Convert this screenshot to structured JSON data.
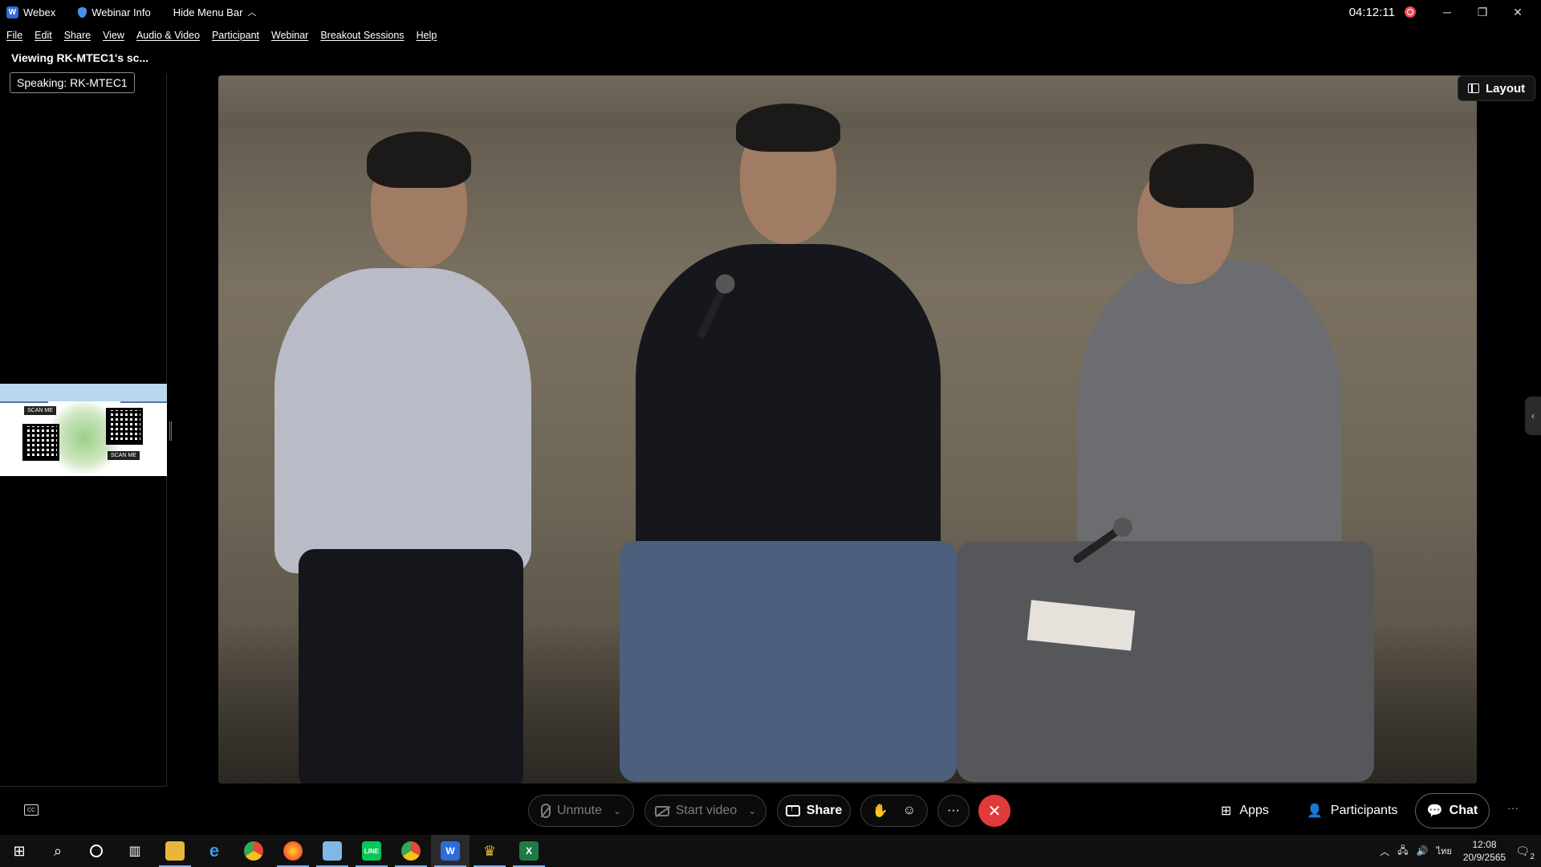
{
  "titlebar": {
    "app_name": "Webex",
    "webinar_info": "Webinar Info",
    "hide_menu": "Hide Menu Bar",
    "clock": "04:12:11"
  },
  "menu": [
    "File",
    "Edit",
    "Share",
    "View",
    "Audio & Video",
    "Participant",
    "Webinar",
    "Breakout Sessions",
    "Help"
  ],
  "left_panel": {
    "viewing": "Viewing RK-MTEC1's sc...",
    "speaking": "Speaking: RK-MTEC1",
    "thumb_tags": [
      "SCAN ME",
      "SCAN ME"
    ]
  },
  "video": {
    "layout_label": "Layout"
  },
  "controls": {
    "unmute": "Unmute",
    "start_video": "Start video",
    "share": "Share",
    "more": "···",
    "apps": "Apps",
    "participants": "Participants",
    "chat": "Chat"
  },
  "taskbar": {
    "time": "12:08",
    "date": "20/9/2565",
    "language": "ไทย",
    "notifications": "2"
  },
  "colors": {
    "end_button": "#e23a3a",
    "record_dot": "#ef4a59",
    "webex_blue": "#2e6bd9"
  }
}
